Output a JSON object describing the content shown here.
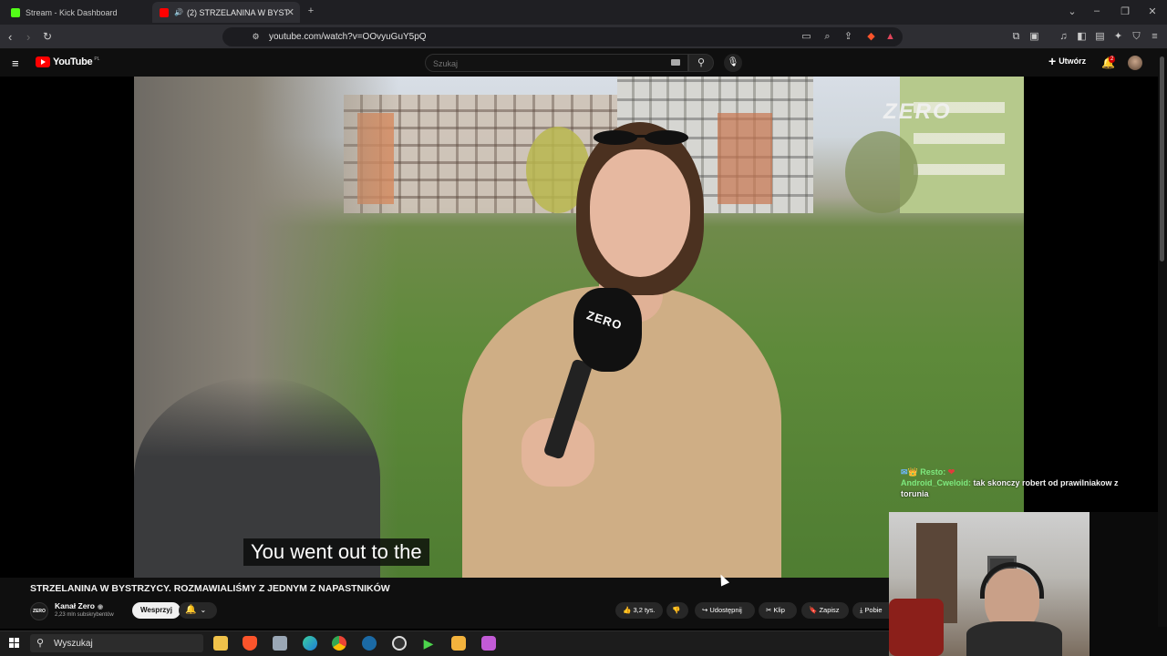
{
  "browser": {
    "tabs": [
      {
        "label": "Stream - Kick Dashboard",
        "favicon_color": "#53fc18"
      },
      {
        "label": "(2) STRZELANINA W BYSTRZY",
        "favicon_color": "#ff0000"
      }
    ],
    "url": "youtube.com/watch?v=OOvyuGuY5pQ"
  },
  "youtube": {
    "logo_text": "YouTube",
    "region": "PL",
    "search_placeholder": "Szukaj",
    "create_label": "Utwórz",
    "notifications_count": "2"
  },
  "video": {
    "brand": "ZERO",
    "mic_label": "ZERO",
    "subtitle": "You went out to the",
    "title": "STRZELANINA W BYSTRZYCY. ROZMAWIALIŚMY Z JEDNYM Z NAPASTNIKÓW",
    "channel_avatar_text": "ZERO",
    "channel_name": "Kanał Zero",
    "subscribers": "2,23 mln subskrybentów",
    "support_label": "Wesprzyj",
    "actions": {
      "likes": "3,2 tys.",
      "share": "Udostępnij",
      "clip": "Klip",
      "save": "Zapisz",
      "download": "Pobie"
    }
  },
  "chat": {
    "line1_user": "Resto:",
    "line2_user": "Android_Cweloid:",
    "line2_msg": "tak skonczy robert od prawilniakow z torunia"
  },
  "taskbar": {
    "search_placeholder": "Wyszukaj",
    "apps": [
      "file-explorer",
      "brave",
      "files",
      "edge",
      "chrome",
      "steam",
      "obs",
      "media-player",
      "app",
      "app2"
    ]
  }
}
